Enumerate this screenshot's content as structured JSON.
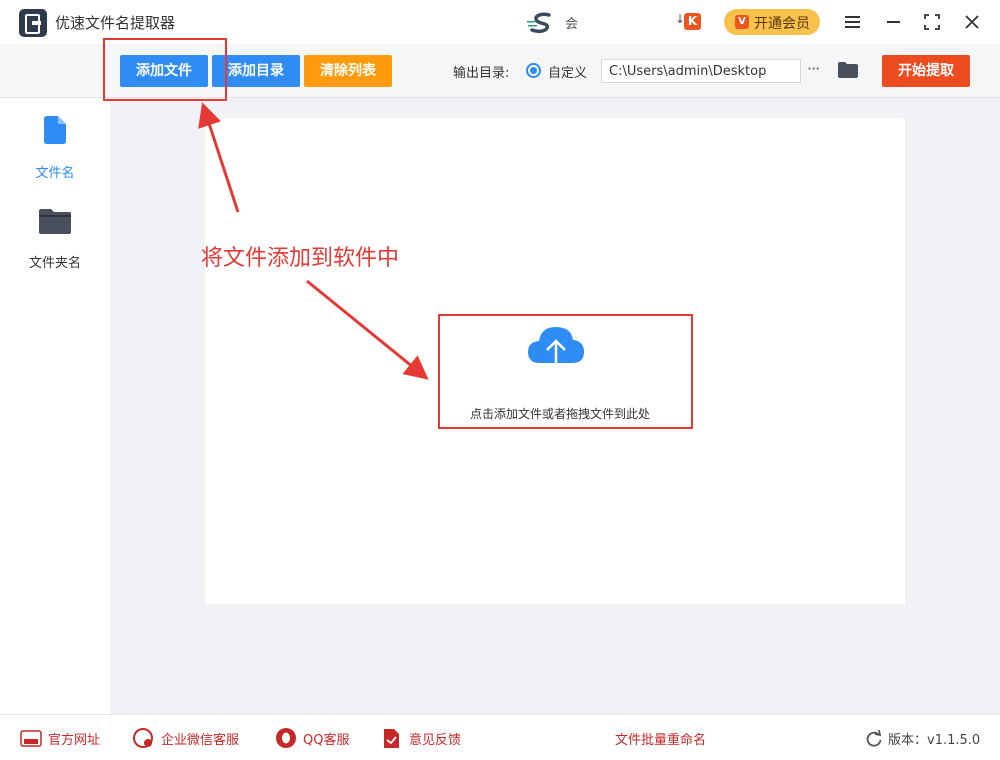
{
  "app": {
    "title": "优速文件名提取器",
    "ad_text": "会",
    "vip_label": "开通会员",
    "vip_icon_text": "V",
    "kk_icon_text": "K"
  },
  "toolbar": {
    "add_file_label": "添加文件",
    "add_dir_label": "添加目录",
    "clear_list_label": "清除列表",
    "output_dir_label": "输出目录:",
    "custom_radio_label": "自定义",
    "output_path_value": "C:\\Users\\admin\\Desktop",
    "more_label": "···",
    "start_label": "开始提取"
  },
  "sidebar": {
    "items": [
      {
        "label": "文件名",
        "icon": "file-icon",
        "active": true
      },
      {
        "label": "文件夹名",
        "icon": "folder-icon",
        "active": false
      }
    ]
  },
  "main": {
    "upload_hint": "点击添加文件或者拖拽文件到此处"
  },
  "annotation": {
    "text": "将文件添加到软件中",
    "color": "#e53935"
  },
  "statusbar": {
    "website_label": "官方网址",
    "wechat_label": "企业微信客服",
    "qq_label": "QQ客服",
    "feedback_label": "意见反馈",
    "rename_link": "文件批量重命名",
    "version_label": "版本：v1.1.5.0"
  },
  "colors": {
    "primary": "#2f8cf4",
    "warning": "#ff9b0d",
    "danger": "#ed4b20",
    "vip": "#f7c14c",
    "link_red": "#c62828"
  }
}
